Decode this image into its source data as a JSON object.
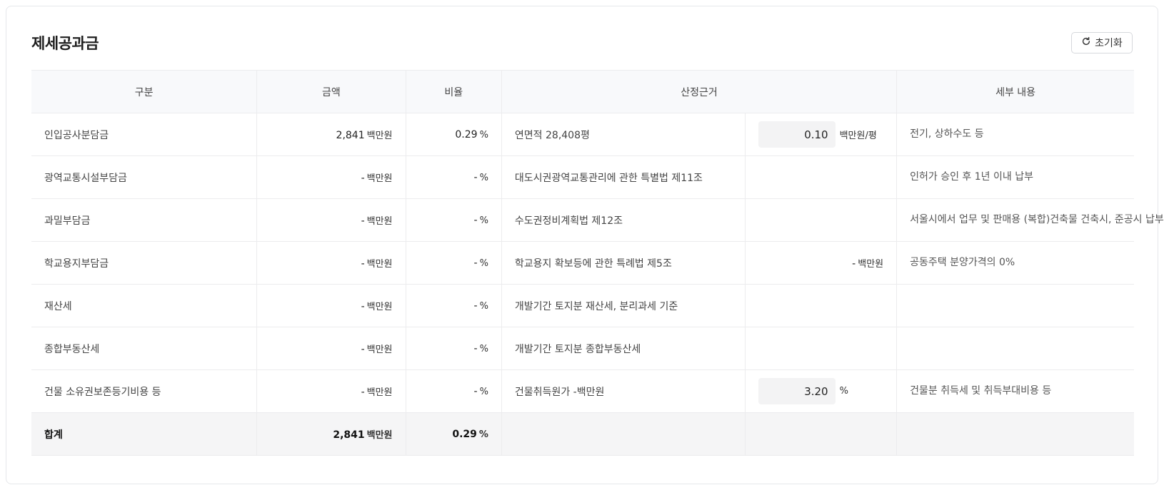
{
  "title": "제세공과금",
  "reset_label": "초기화",
  "headers": [
    "구분",
    "금액",
    "비율",
    "산정근거",
    "세부 내용"
  ],
  "rows": [
    {
      "label": "인입공사분담금",
      "amount": "2,841",
      "amount_unit": "백만원",
      "ratio": "0.29",
      "ratio_unit": "%",
      "basis": "연면적 28,408평",
      "input_value": "0.10",
      "input_unit": "백만원/평",
      "detail": "전기, 상하수도 등"
    },
    {
      "label": "광역교통시설부담금",
      "amount": "-",
      "amount_unit": "백만원",
      "ratio": "-",
      "ratio_unit": "%",
      "basis": "대도시권광역교통관리에 관한 특별법 제11조",
      "detail": "인허가 승인 후 1년 이내 납부"
    },
    {
      "label": "과밀부담금",
      "amount": "-",
      "amount_unit": "백만원",
      "ratio": "-",
      "ratio_unit": "%",
      "basis": "수도권정비계획법 제12조",
      "detail": "서울시에서 업무 및 판매용 (복합)건축물 건축시, 준공시 납부"
    },
    {
      "label": "학교용지부담금",
      "amount": "-",
      "amount_unit": "백만원",
      "ratio": "-",
      "ratio_unit": "%",
      "basis": "학교용지 확보등에 관한 특례법 제5조",
      "extra_value": "-",
      "extra_unit": "백만원",
      "detail": "공동주택 분양가격의 0%"
    },
    {
      "label": "재산세",
      "amount": "-",
      "amount_unit": "백만원",
      "ratio": "-",
      "ratio_unit": "%",
      "basis": "개발기간 토지분 재산세, 분리과세 기준",
      "detail": ""
    },
    {
      "label": "종합부동산세",
      "amount": "-",
      "amount_unit": "백만원",
      "ratio": "-",
      "ratio_unit": "%",
      "basis": "개발기간 토지분 종합부동산세",
      "detail": ""
    },
    {
      "label": "건물 소유권보존등기비용 등",
      "amount": "-",
      "amount_unit": "백만원",
      "ratio": "-",
      "ratio_unit": "%",
      "basis": "건물취득원가 -백만원",
      "input_value": "3.20",
      "input_unit": "%",
      "detail": "건물분 취득세 및 취득부대비용 등"
    }
  ],
  "total": {
    "label": "합계",
    "amount": "2,841",
    "amount_unit": "백만원",
    "ratio": "0.29",
    "ratio_unit": "%"
  }
}
